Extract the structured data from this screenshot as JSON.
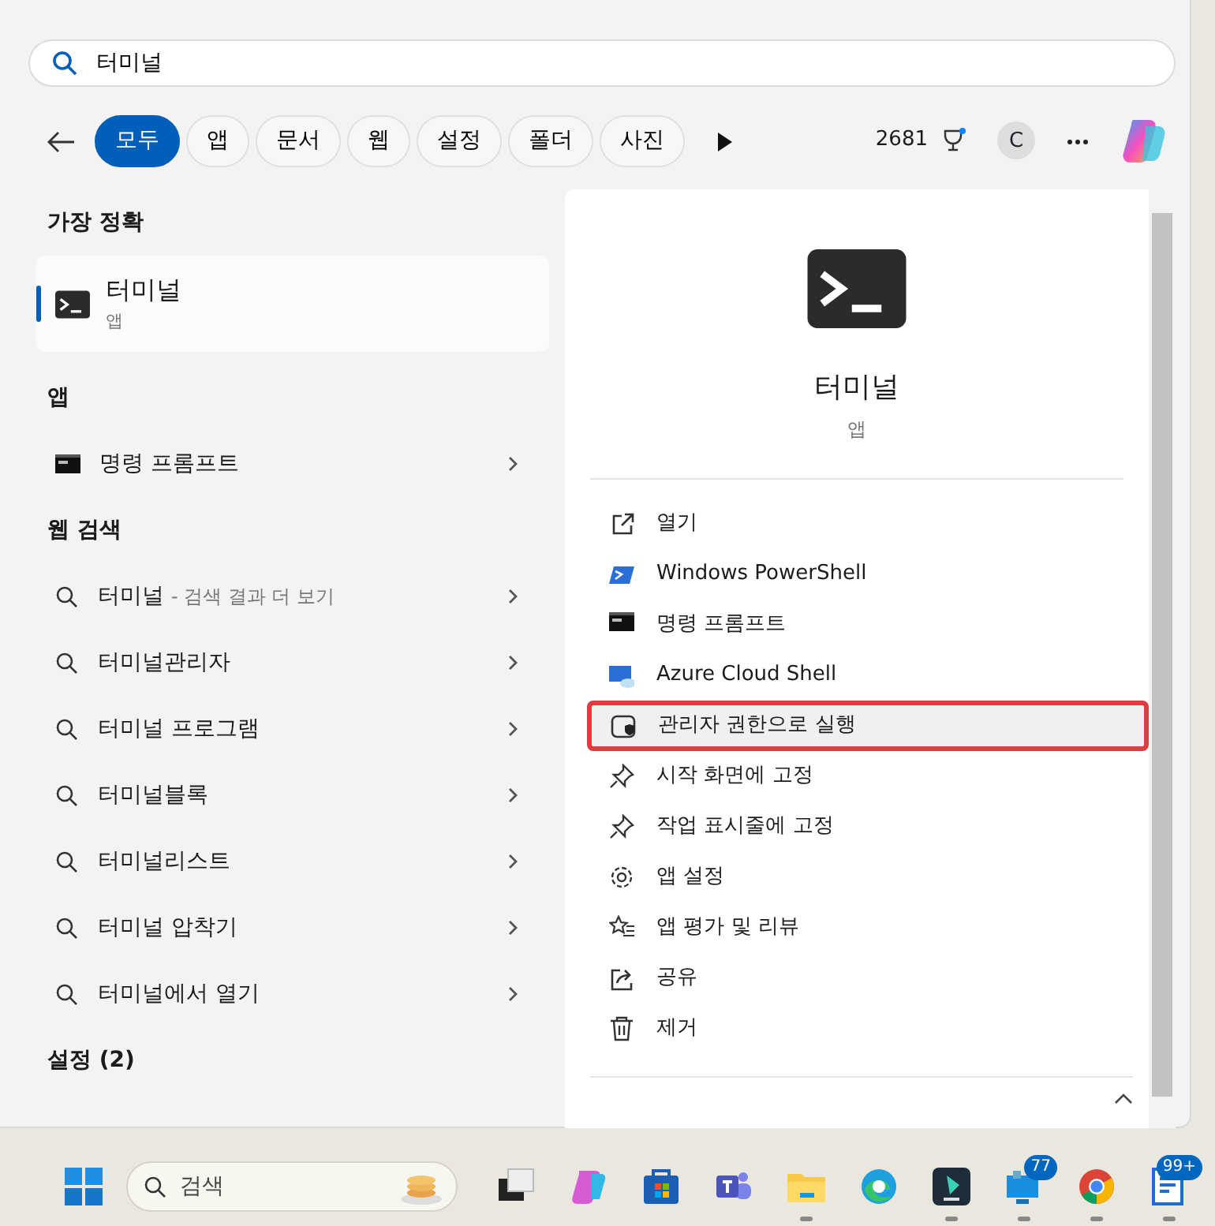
{
  "search": {
    "value": "터미널"
  },
  "filters": [
    {
      "label": "모두",
      "selected": true
    },
    {
      "label": "앱",
      "selected": false
    },
    {
      "label": "문서",
      "selected": false
    },
    {
      "label": "웹",
      "selected": false
    },
    {
      "label": "설정",
      "selected": false
    },
    {
      "label": "폴더",
      "selected": false
    },
    {
      "label": "사진",
      "selected": false
    }
  ],
  "points": "2681",
  "avatar": "C",
  "best_match": {
    "heading": "가장 정확",
    "title": "터미널",
    "subtitle": "앱",
    "selected": true
  },
  "apps": {
    "heading": "앱",
    "items": [
      {
        "label": "명령 프롬프트"
      }
    ]
  },
  "web_search": {
    "heading": "웹 검색",
    "items": [
      {
        "label": "터미널",
        "hint": "- 검색 결과 더 보기"
      },
      {
        "label": "터미널관리자"
      },
      {
        "label": "터미널 프로그램"
      },
      {
        "label": "터미널블록"
      },
      {
        "label": "터미널리스트"
      },
      {
        "label": "터미널 압착기"
      },
      {
        "label": "터미널에서 열기"
      }
    ]
  },
  "settings": {
    "heading": "설정 (2)"
  },
  "detail": {
    "title": "터미널",
    "subtitle": "앱",
    "actions": [
      {
        "kind": "open",
        "label": "열기",
        "highlighted": false
      },
      {
        "kind": "powershell",
        "label": "Windows PowerShell",
        "highlighted": false
      },
      {
        "kind": "cmd",
        "label": "명령 프롬프트",
        "highlighted": false
      },
      {
        "kind": "azure",
        "label": "Azure Cloud Shell",
        "highlighted": false
      },
      {
        "kind": "admin",
        "label": "관리자 권한으로 실행",
        "highlighted": true
      },
      {
        "kind": "pin",
        "label": "시작 화면에 고정",
        "highlighted": false
      },
      {
        "kind": "pin",
        "label": "작업 표시줄에 고정",
        "highlighted": false
      },
      {
        "kind": "gear",
        "label": "앱 설정",
        "highlighted": false
      },
      {
        "kind": "star",
        "label": "앱 평가 및 리뷰",
        "highlighted": false
      },
      {
        "kind": "share",
        "label": "공유",
        "highlighted": false
      },
      {
        "kind": "trash",
        "label": "제거",
        "highlighted": false
      }
    ]
  },
  "taskbar": {
    "search_placeholder": "검색",
    "items": [
      {
        "kind": "taskview",
        "running": false
      },
      {
        "kind": "copilot",
        "running": false
      },
      {
        "kind": "store",
        "running": false
      },
      {
        "kind": "teams",
        "running": false
      },
      {
        "kind": "folder",
        "running": true
      },
      {
        "kind": "edge",
        "running": false
      },
      {
        "kind": "editor",
        "running": true
      },
      {
        "kind": "remote",
        "running": true,
        "badge": "77"
      },
      {
        "kind": "chrome",
        "running": true
      },
      {
        "kind": "document",
        "running": true,
        "badge": "99+"
      }
    ]
  }
}
